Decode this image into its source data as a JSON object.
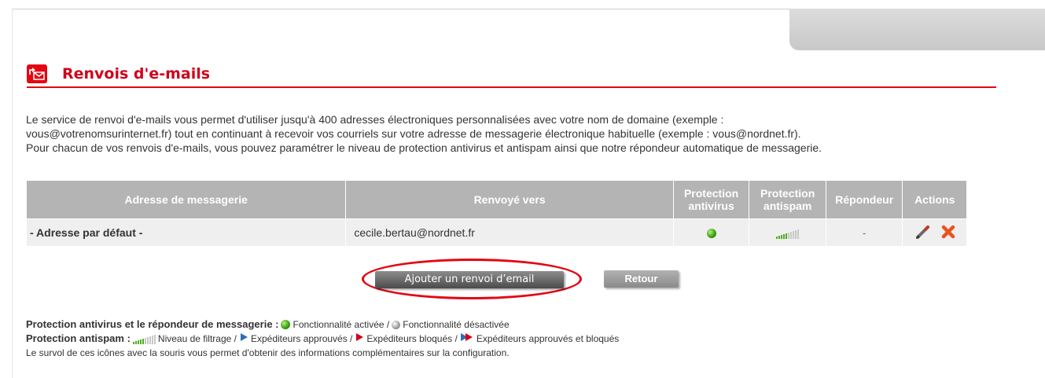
{
  "page": {
    "title": "Renvois d'e-mails",
    "intro_lines": [
      "Le service de renvoi d'e-mails vous permet d'utiliser jusqu'à 400 adresses électroniques personnalisées avec votre nom de domaine (exemple :",
      "vous@votrenomsurinternet.fr) tout en continuant à recevoir vos courriels sur votre adresse de messagerie électronique habituelle (exemple : vous@nordnet.fr).",
      "Pour chacun de vos renvois d'e-mails, vous pouvez paramétrer le niveau de protection antivirus et antispam ainsi que notre répondeur automatique de messagerie."
    ]
  },
  "table": {
    "headers": {
      "address": "Adresse de messagerie",
      "target": "Renvoyé vers",
      "antivirus_1": "Protection",
      "antivirus_2": "antivirus",
      "antispam_1": "Protection",
      "antispam_2": "antispam",
      "responder": "Répondeur",
      "actions": "Actions"
    },
    "rows": [
      {
        "address": "- Adresse par défaut -",
        "target": "cecile.bertau@nordnet.fr",
        "antivirus": "enabled",
        "antispam_level": 0.5,
        "responder": "-"
      }
    ]
  },
  "buttons": {
    "add": "Ajouter un renvoi d’email",
    "back": "Retour"
  },
  "legend": {
    "line1_label": "Protection antivirus et le répondeur de messagerie :",
    "enabled": "Fonctionnalité activée /",
    "disabled": "Fonctionnalité désactivée",
    "line2_label": "Protection antispam :",
    "filter_level": "Niveau de filtrage /",
    "approved": "Expéditeurs approuvés /",
    "blocked": "Expéditeurs bloqués /",
    "approved_blocked": "Expéditeurs approuvés et bloqués",
    "hover_note": "Le survol de ces icônes avec la souris vous permet d'obtenir des informations complémentaires sur la configuration."
  },
  "colors": {
    "brand_red": "#e30613",
    "header_grey": "#b4b4b4",
    "row_grey": "#efefef",
    "enabled_green": "#3aa313"
  },
  "icons": {
    "section": "email-forward-icon",
    "edit": "pencil-icon",
    "delete": "delete-x-icon"
  }
}
